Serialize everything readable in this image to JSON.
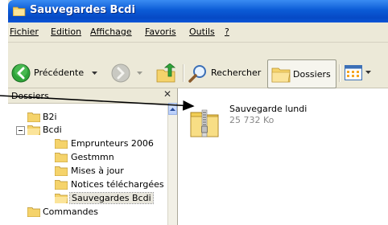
{
  "window": {
    "title": "Sauvegardes Bcdi"
  },
  "menu": {
    "items": [
      {
        "label": "Fichier"
      },
      {
        "label": "Edition"
      },
      {
        "label": "Affichage"
      },
      {
        "label": "Favoris"
      },
      {
        "label": "Outils"
      },
      {
        "label": "?"
      }
    ]
  },
  "toolbar": {
    "back_label": "Précédente",
    "search_label": "Rechercher",
    "folders_label": "Dossiers"
  },
  "folders_pane": {
    "title": "Dossiers",
    "items": [
      {
        "label": "B2i",
        "level": 1,
        "expander": "none"
      },
      {
        "label": "Bcdi",
        "level": 1,
        "expander": "minus"
      },
      {
        "label": "Emprunteurs 2006",
        "level": 2,
        "expander": "none"
      },
      {
        "label": "Gestmmn",
        "level": 2,
        "expander": "none"
      },
      {
        "label": "Mises à jour",
        "level": 2,
        "expander": "none"
      },
      {
        "label": "Notices téléchargées",
        "level": 2,
        "expander": "none"
      },
      {
        "label": "Sauvegardes Bcdi",
        "level": 2,
        "expander": "none",
        "selected": true
      },
      {
        "label": "Commandes",
        "level": 1,
        "expander": "none"
      }
    ]
  },
  "content": {
    "file": {
      "name": "Sauvegarde lundi",
      "size": "25 732 Ko"
    }
  },
  "colors": {
    "titlebar": "#0B5BD6",
    "chrome": "#ECE9D8",
    "folder": "#F5D36B"
  }
}
